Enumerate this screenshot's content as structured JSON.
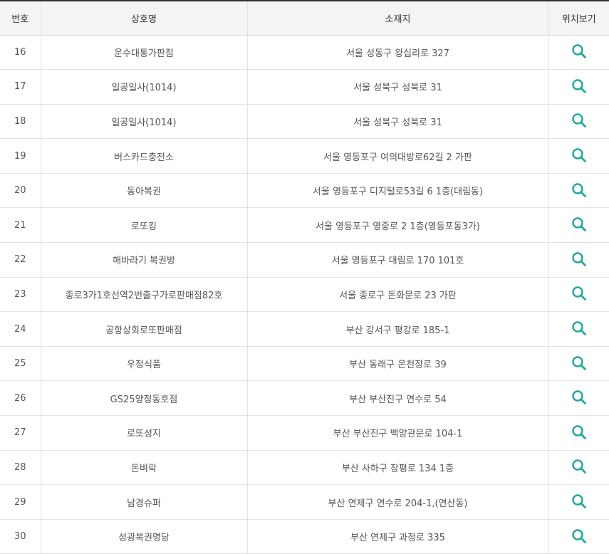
{
  "table": {
    "headers": {
      "num": "번호",
      "name": "상호명",
      "address": "소재지",
      "map": "위치보기"
    },
    "rows": [
      {
        "num": "16",
        "name": "운수대통가판점",
        "address": "서울 성동구 왕십리로 327"
      },
      {
        "num": "17",
        "name": "일공일사(1014)",
        "address": "서울 성북구 성북로 31"
      },
      {
        "num": "18",
        "name": "일공일사(1014)",
        "address": "서울 성북구 성북로 31"
      },
      {
        "num": "19",
        "name": "버스카드충전소",
        "address": "서울 영등포구 여의대방로62길 2 가판"
      },
      {
        "num": "20",
        "name": "동아복권",
        "address": "서울 영등포구 디지털로53길 6 1층(대림동)"
      },
      {
        "num": "21",
        "name": "로또킹",
        "address": "서울 영등포구 영중로 2 1층(영등포동3가)"
      },
      {
        "num": "22",
        "name": "해바라기 복권방",
        "address": "서울 영등포구 대림로 170 101호"
      },
      {
        "num": "23",
        "name": "종로3가1호선역2번출구가로판매점82호",
        "address": "서울 종로구 돈화문로 23 가판"
      },
      {
        "num": "24",
        "name": "공항상회로또판매점",
        "address": "부산 강서구 평강로 185-1"
      },
      {
        "num": "25",
        "name": "우정식품",
        "address": "부산 동래구 온천장로 39"
      },
      {
        "num": "26",
        "name": "GS25양정동호점",
        "address": "부산 부산진구 연수로 54"
      },
      {
        "num": "27",
        "name": "로또성지",
        "address": "부산 부산진구 백양관문로 104-1"
      },
      {
        "num": "28",
        "name": "돈벼락",
        "address": "부산 사하구 장평로 134 1층"
      },
      {
        "num": "29",
        "name": "남경슈퍼",
        "address": "부산 연제구 연수로 204-1,(연산동)"
      },
      {
        "num": "30",
        "name": "성광복권명당",
        "address": "부산 연제구 과정로 335"
      }
    ]
  },
  "icons": {
    "map": "search-icon"
  },
  "colors": {
    "accent": "#1fa99a",
    "header_bg": "#f4f4f4",
    "header_top_border": "#333333",
    "row_border": "#e2e2e2",
    "text": "#555555"
  }
}
